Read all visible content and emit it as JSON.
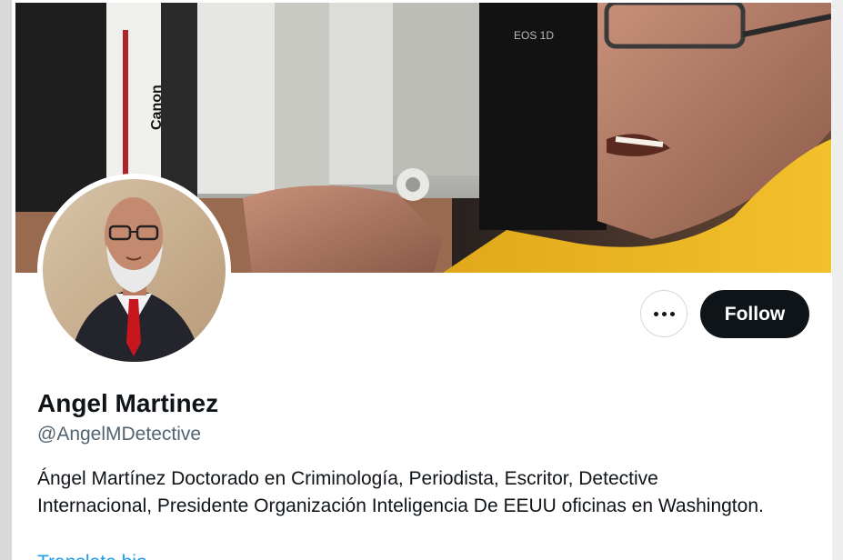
{
  "profile": {
    "display_name": "Angel Martinez",
    "handle": "@AngelMDetective",
    "bio": "Ángel Martínez Doctorado en Criminología, Periodista, Escritor, Detective Internacional, Presidente Organización Inteligencia De EEUU oficinas en Washington.",
    "translate_label": "Translate bio"
  },
  "actions": {
    "more_icon": "more-horizontal-icon",
    "follow_label": "Follow"
  },
  "banner": {
    "lens_brand_text": "Canon",
    "camera_model_text": "EOS 1D"
  },
  "colors": {
    "follow_bg": "#0f1419",
    "handle_text": "#536471",
    "link_blue": "#1d9bf0"
  }
}
